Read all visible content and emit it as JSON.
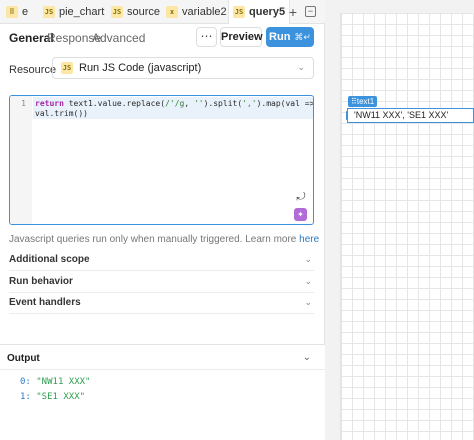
{
  "tabs": [
    {
      "label": "e",
      "icon": "generic-query-icon",
      "active": false
    },
    {
      "label": "pie_chart",
      "icon": "js-query-icon",
      "active": false
    },
    {
      "label": "source",
      "icon": "js-query-icon",
      "active": false
    },
    {
      "label": "variable2",
      "icon": "variable-icon",
      "active": false
    },
    {
      "label": "query5",
      "icon": "js-query-icon",
      "active": true
    }
  ],
  "tabbar_icons": {
    "add": "plus-icon",
    "collapse": "collapse-panel-icon"
  },
  "subtabs": [
    "General",
    "Response",
    "Advanced"
  ],
  "toolbar": {
    "more": "⋯",
    "preview": "Preview",
    "run": "Run",
    "run_shortcut": "⌘↵"
  },
  "resource": {
    "label": "Resource",
    "value": "Run JS Code (javascript)",
    "icon_text": "JS"
  },
  "editor": {
    "line_number": "1",
    "keyword": "return",
    "code_part1": " text1.value.replace(",
    "regex": "/'/g",
    "code_part2": ", ",
    "empty_str": "''",
    "code_part3": ").split(",
    "comma_str": "','",
    "code_part4": ").map(val =>",
    "code_line2": "val.trim())"
  },
  "hint": {
    "text": "Javascript queries run only when manually triggered. Learn more ",
    "link": "here"
  },
  "sections": [
    "Additional scope",
    "Run behavior",
    "Event handlers"
  ],
  "output": {
    "title": "Output",
    "rows": [
      {
        "index": "0:",
        "value": "\"NW11 XXX\""
      },
      {
        "index": "1:",
        "value": "\"SE1 XXX\""
      }
    ]
  },
  "canvas": {
    "component_label": "text1",
    "component_value": "'NW11 XXX', 'SE1 XXX'"
  }
}
